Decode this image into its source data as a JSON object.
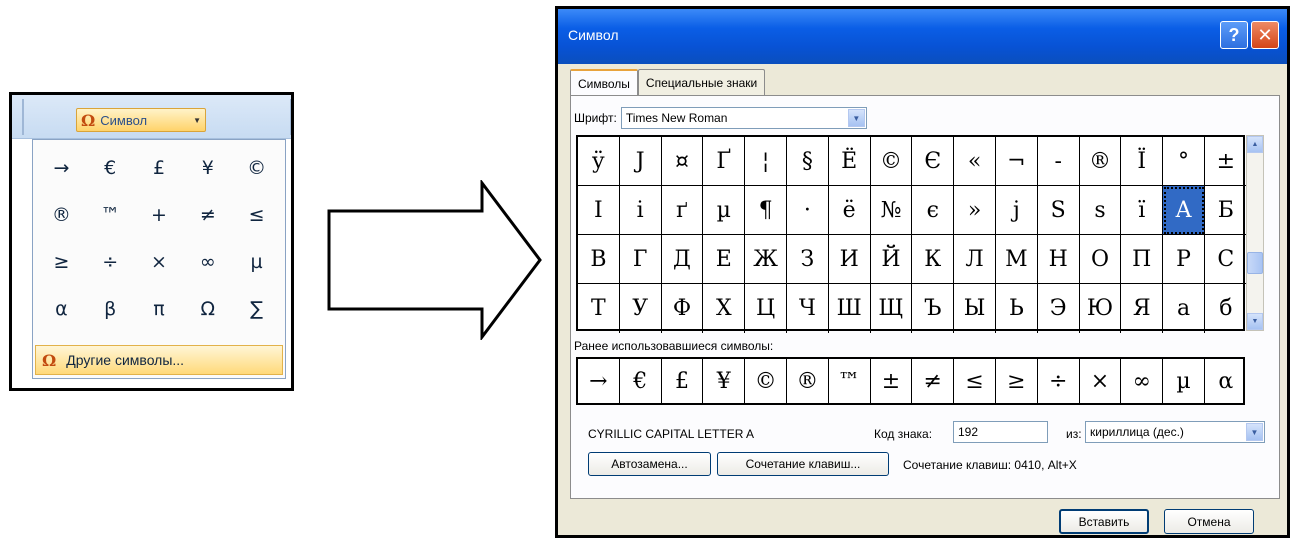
{
  "ribbon": {
    "button_label": "Символ",
    "button_icon": "omega-icon",
    "dropdown_symbols": [
      "→",
      "€",
      "£",
      "¥",
      "©",
      "®",
      "™",
      "+",
      "≠",
      "≤",
      "≥",
      "÷",
      "×",
      "∞",
      "µ",
      "α",
      "β",
      "π",
      "Ω",
      "∑"
    ],
    "more_label": "Другие символы..."
  },
  "dialog": {
    "title": "Символ",
    "tabs": [
      "Символы",
      "Специальные знаки"
    ],
    "font_label": "Шрифт:",
    "font_value": "Times New Roman",
    "symbols": [
      [
        "ÿ",
        "Ј",
        "¤",
        "Ґ",
        "¦",
        "§",
        "Ё",
        "©",
        "Є",
        "«",
        "¬",
        "-",
        "®",
        "Ї",
        "°",
        "±"
      ],
      [
        "І",
        "і",
        "ґ",
        "µ",
        "¶",
        "·",
        "ё",
        "№",
        "є",
        "»",
        "ј",
        "Ѕ",
        "ѕ",
        "ї",
        "А",
        "Б"
      ],
      [
        "В",
        "Г",
        "Д",
        "Е",
        "Ж",
        "З",
        "И",
        "Й",
        "К",
        "Л",
        "М",
        "Н",
        "О",
        "П",
        "Р",
        "С"
      ],
      [
        "Т",
        "У",
        "Ф",
        "Х",
        "Ц",
        "Ч",
        "Ш",
        "Щ",
        "Ъ",
        "Ы",
        "Ь",
        "Э",
        "Ю",
        "Я",
        "а",
        "б"
      ]
    ],
    "selected_symbol": "А",
    "recent_label": "Ранее использовавшиеся символы:",
    "recent_symbols": [
      "→",
      "€",
      "£",
      "¥",
      "©",
      "®",
      "™",
      "±",
      "≠",
      "≤",
      "≥",
      "÷",
      "×",
      "∞",
      "µ",
      "α"
    ],
    "char_name": "CYRILLIC CAPITAL LETTER A",
    "code_label": "Код знака:",
    "code_value": "192",
    "from_label": "из:",
    "from_value": "кириллица (дес.)",
    "autocorrect_label": "Автозамена...",
    "shortcut_button_label": "Сочетание клавиш...",
    "shortcut_text": "Сочетание клавиш: 0410, Alt+X",
    "insert_label": "Вставить",
    "cancel_label": "Отмена",
    "help_label": "?",
    "close_label": "✕"
  }
}
